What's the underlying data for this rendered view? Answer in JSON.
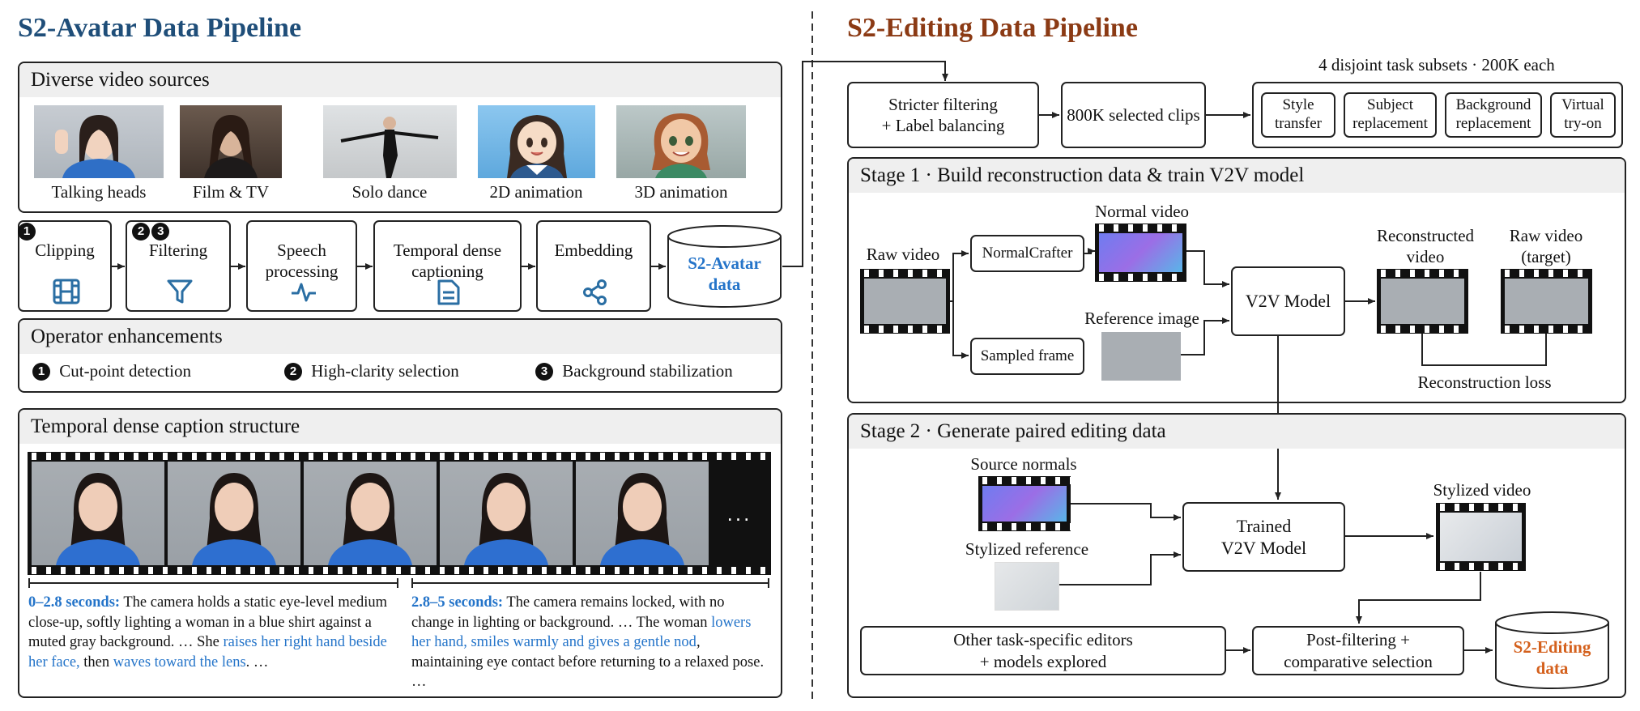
{
  "left": {
    "title": "S2-Avatar Data Pipeline",
    "sources": {
      "header": "Diverse video sources",
      "items": [
        "Talking heads",
        "Film & TV",
        "Solo dance",
        "2D animation",
        "3D animation"
      ]
    },
    "steps": [
      {
        "label": "Clipping",
        "badges": [
          "1"
        ],
        "icon": "film-icon"
      },
      {
        "label": "Filtering",
        "badges": [
          "2",
          "3"
        ],
        "icon": "filter-icon"
      },
      {
        "label": "Speech processing",
        "icon": "waveform-icon"
      },
      {
        "label": "Temporal dense captioning",
        "icon": "document-icon"
      },
      {
        "label": "Embedding",
        "icon": "share-icon"
      }
    ],
    "output": "S2-Avatar data",
    "operators": {
      "header": "Operator enhancements",
      "items": [
        {
          "badge": "1",
          "label": "Cut-point detection"
        },
        {
          "badge": "2",
          "label": "High-clarity selection"
        },
        {
          "badge": "3",
          "label": "Background stabilization"
        }
      ]
    },
    "caption_structure": {
      "header": "Temporal dense caption structure",
      "ellipsis": "...",
      "segments": [
        {
          "time": "0–2.8 seconds:",
          "parts": [
            {
              "t": " The camera holds a static eye-level medium close-up, softly lighting a woman in a blue shirt against a muted gray background. … She ",
              "h": false
            },
            {
              "t": "raises her right hand beside her face,",
              "h": true
            },
            {
              "t": " then ",
              "h": false
            },
            {
              "t": "waves toward the lens",
              "h": true
            },
            {
              "t": ". …",
              "h": false
            }
          ]
        },
        {
          "time": "2.8–5 seconds:",
          "parts": [
            {
              "t": " The camera remains locked, with no change in lighting or background. … The woman ",
              "h": false
            },
            {
              "t": "lowers her hand, smiles warmly and gives a gentle nod",
              "h": true
            },
            {
              "t": ", maintaining eye contact before returning to a relaxed pose. …",
              "h": false
            }
          ]
        }
      ]
    }
  },
  "right": {
    "title": "S2-Editing Data Pipeline",
    "filter_box": "Stricter filtering\n+ Label balancing",
    "selected_box": "800K selected clips",
    "subsets_label": "4 disjoint task subsets · 200K each",
    "subsets": [
      "Style\ntransfer",
      "Subject\nreplacement",
      "Background\nreplacement",
      "Virtual\ntry-on"
    ],
    "stage1": {
      "header": "Stage 1 · Build reconstruction data & train V2V model",
      "raw_video": "Raw video",
      "normalcrafter": "NormalCrafter",
      "normal_video": "Normal video",
      "sampled_frame": "Sampled frame",
      "reference_image": "Reference image",
      "model": "V2V Model",
      "reconstructed": "Reconstructed\nvideo",
      "raw_target": "Raw video\n(target)",
      "loss": "Reconstruction loss"
    },
    "stage2": {
      "header": "Stage 2 · Generate paired editing data",
      "source_normals": "Source normals",
      "stylized_reference": "Stylized reference",
      "trained_model": "Trained\nV2V Model",
      "stylized_video": "Stylized video",
      "other_editors": "Other task-specific editors\n+ models explored",
      "post_filter": "Post-filtering +\ncomparative selection",
      "output": "S2-Editing\ndata"
    }
  },
  "colors": {
    "left_title": "#1f4e79",
    "right_title": "#8b3a14",
    "accent_blue": "#2474c9",
    "accent_orange": "#d4601c",
    "panel_header": "#efefef"
  }
}
